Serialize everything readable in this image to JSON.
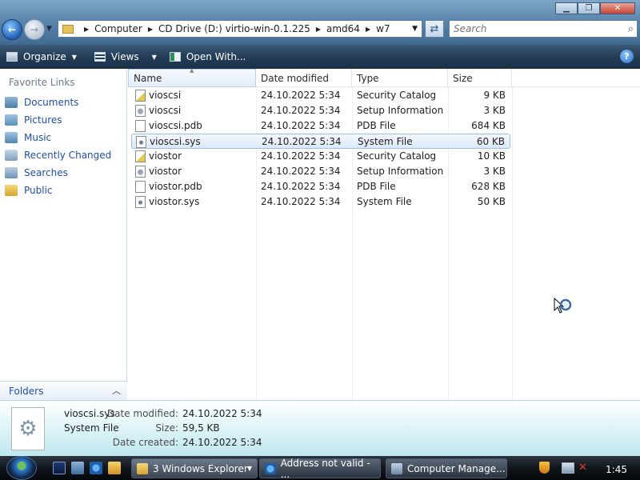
{
  "window": {
    "controls": [
      "minimize",
      "maximize",
      "close"
    ]
  },
  "address": {
    "crumbs": [
      "Computer",
      "CD Drive (D:) virtio-win-0.1.225",
      "amd64",
      "w7"
    ]
  },
  "search": {
    "placeholder": "Search"
  },
  "toolbar": {
    "organize": "Organize",
    "views": "Views",
    "open_with": "Open With...",
    "help": "?"
  },
  "nav": {
    "favorite_links_title": "Favorite Links",
    "items": [
      {
        "label": "Documents",
        "icon": "documents-icon"
      },
      {
        "label": "Pictures",
        "icon": "pictures-icon"
      },
      {
        "label": "Music",
        "icon": "music-icon"
      },
      {
        "label": "Recently Changed",
        "icon": "recently-changed-icon"
      },
      {
        "label": "Searches",
        "icon": "searches-icon"
      },
      {
        "label": "Public",
        "icon": "public-folder-icon"
      }
    ],
    "folders_label": "Folders"
  },
  "columns": {
    "name": "Name",
    "date": "Date modified",
    "type": "Type",
    "size": "Size"
  },
  "files": [
    {
      "name": "vioscsi",
      "date": "24.10.2022 5:34",
      "type": "Security Catalog",
      "size": "9 KB",
      "icon": "cat",
      "selected": false
    },
    {
      "name": "vioscsi",
      "date": "24.10.2022 5:34",
      "type": "Setup Information",
      "size": "3 KB",
      "icon": "inf",
      "selected": false
    },
    {
      "name": "vioscsi.pdb",
      "date": "24.10.2022 5:34",
      "type": "PDB File",
      "size": "684 KB",
      "icon": "pdb",
      "selected": false
    },
    {
      "name": "vioscsi.sys",
      "date": "24.10.2022 5:34",
      "type": "System File",
      "size": "60 KB",
      "icon": "sys",
      "selected": true
    },
    {
      "name": "viostor",
      "date": "24.10.2022 5:34",
      "type": "Security Catalog",
      "size": "10 KB",
      "icon": "cat",
      "selected": false
    },
    {
      "name": "viostor",
      "date": "24.10.2022 5:34",
      "type": "Setup Information",
      "size": "3 KB",
      "icon": "inf",
      "selected": false
    },
    {
      "name": "viostor.pdb",
      "date": "24.10.2022 5:34",
      "type": "PDB File",
      "size": "628 KB",
      "icon": "pdb",
      "selected": false
    },
    {
      "name": "viostor.sys",
      "date": "24.10.2022 5:34",
      "type": "System File",
      "size": "50 KB",
      "icon": "sys",
      "selected": false
    }
  ],
  "details": {
    "filename": "vioscsi.sys",
    "filetype": "System File",
    "modified_label": "Date modified:",
    "modified_value": "24.10.2022 5:34",
    "size_label": "Size:",
    "size_value": "59,5 KB",
    "created_label": "Date created:",
    "created_value": "24.10.2022 5:34"
  },
  "taskbar": {
    "tasks": [
      {
        "label": "3 Windows Explorer",
        "icon": "folder-icon"
      },
      {
        "label": "Address not valid - ...",
        "icon": "internet-explorer-icon"
      },
      {
        "label": "Computer Manage...",
        "icon": "computer-management-icon"
      }
    ],
    "clock": "1:45"
  },
  "colors": {
    "link": "#1f4fa6",
    "selection_border": "#99c0e8",
    "details_bg": "#bfe8ee",
    "taskbar_bg": "#11161d"
  }
}
